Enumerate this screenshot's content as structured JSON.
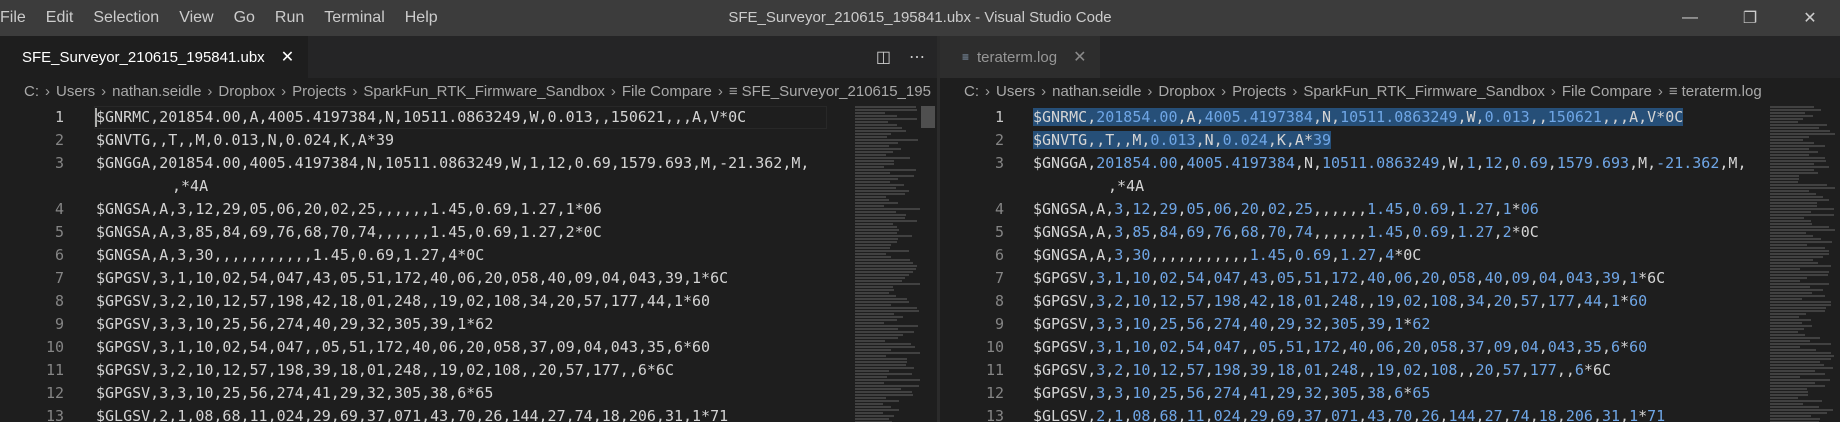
{
  "window": {
    "title": "SFE_Surveyor_210615_195841.ubx - Visual Studio Code",
    "menu": [
      "File",
      "Edit",
      "Selection",
      "View",
      "Go",
      "Run",
      "Terminal",
      "Help"
    ],
    "controls": {
      "minimize": "—",
      "restore": "❐",
      "close": "✕"
    }
  },
  "left_pane": {
    "tab": {
      "label": "SFE_Surveyor_210615_195841.ubx",
      "close": "✕"
    },
    "actions": {
      "split": "◫",
      "more": "⋯"
    },
    "breadcrumb": [
      "C:",
      "Users",
      "nathan.seidle",
      "Dropbox",
      "Projects",
      "SparkFun_RTK_Firmware_Sandbox",
      "File Compare",
      "SFE_Surveyor_210615_195"
    ],
    "lines": [
      {
        "n": "1",
        "text": "$GNRMC,201854.00,A,4005.4197384,N,10511.0863249,W,0.013,,150621,,,A,V*0C"
      },
      {
        "n": "2",
        "text": "$GNVTG,,T,,M,0.013,N,0.024,K,A*39"
      },
      {
        "n": "3",
        "text": "$GNGGA,201854.00,4005.4197384,N,10511.0863249,W,1,12,0.69,1579.693,M,-21.362,M,",
        "cont": ",*4A"
      },
      {
        "n": "4",
        "text": "$GNGSA,A,3,12,29,05,06,20,02,25,,,,,,1.45,0.69,1.27,1*06"
      },
      {
        "n": "5",
        "text": "$GNGSA,A,3,85,84,69,76,68,70,74,,,,,,1.45,0.69,1.27,2*0C"
      },
      {
        "n": "6",
        "text": "$GNGSA,A,3,30,,,,,,,,,,,1.45,0.69,1.27,4*0C"
      },
      {
        "n": "7",
        "text": "$GPGSV,3,1,10,02,54,047,43,05,51,172,40,06,20,058,40,09,04,043,39,1*6C"
      },
      {
        "n": "8",
        "text": "$GPGSV,3,2,10,12,57,198,42,18,01,248,,19,02,108,34,20,57,177,44,1*60"
      },
      {
        "n": "9",
        "text": "$GPGSV,3,3,10,25,56,274,40,29,32,305,39,1*62"
      },
      {
        "n": "10",
        "text": "$GPGSV,3,1,10,02,54,047,,05,51,172,40,06,20,058,37,09,04,043,35,6*60"
      },
      {
        "n": "11",
        "text": "$GPGSV,3,2,10,12,57,198,39,18,01,248,,19,02,108,,20,57,177,,6*6C"
      },
      {
        "n": "12",
        "text": "$GPGSV,3,3,10,25,56,274,41,29,32,305,38,6*65"
      },
      {
        "n": "13",
        "text": "$GLGSV,2,1,08,68,11,024,29,69,37,071,43,70,26,144,27,74,18,206,31,1*71"
      }
    ]
  },
  "right_pane": {
    "tab": {
      "label": "teraterm.log",
      "close": "✕"
    },
    "breadcrumb": [
      "C:",
      "Users",
      "nathan.seidle",
      "Dropbox",
      "Projects",
      "SparkFun_RTK_Firmware_Sandbox",
      "File Compare",
      "teraterm.log"
    ],
    "lines": [
      {
        "n": "1",
        "text": "$GNRMC,201854.00,A,4005.4197384,N,10511.0863249,W,0.013,,150621,,,A,V*0C"
      },
      {
        "n": "2",
        "text": "$GNVTG,,T,,M,0.013,N,0.024,K,A*39"
      },
      {
        "n": "3",
        "text": "$GNGGA,201854.00,4005.4197384,N,10511.0863249,W,1,12,0.69,1579.693,M,-21.362,M,",
        "cont": ",*4A"
      },
      {
        "n": "4",
        "text": "$GNGSA,A,3,12,29,05,06,20,02,25,,,,,,1.45,0.69,1.27,1*06"
      },
      {
        "n": "5",
        "text": "$GNGSA,A,3,85,84,69,76,68,70,74,,,,,,1.45,0.69,1.27,2*0C"
      },
      {
        "n": "6",
        "text": "$GNGSA,A,3,30,,,,,,,,,,,1.45,0.69,1.27,4*0C"
      },
      {
        "n": "7",
        "text": "$GPGSV,3,1,10,02,54,047,43,05,51,172,40,06,20,058,40,09,04,043,39,1*6C"
      },
      {
        "n": "8",
        "text": "$GPGSV,3,2,10,12,57,198,42,18,01,248,,19,02,108,34,20,57,177,44,1*60"
      },
      {
        "n": "9",
        "text": "$GPGSV,3,3,10,25,56,274,40,29,32,305,39,1*62"
      },
      {
        "n": "10",
        "text": "$GPGSV,3,1,10,02,54,047,,05,51,172,40,06,20,058,37,09,04,043,35,6*60"
      },
      {
        "n": "11",
        "text": "$GPGSV,3,2,10,12,57,198,39,18,01,248,,19,02,108,,20,57,177,,6*6C"
      },
      {
        "n": "12",
        "text": "$GPGSV,3,3,10,25,56,274,41,29,32,305,38,6*65"
      },
      {
        "n": "13",
        "text": "$GLGSV,2,1,08,68,11,024,29,69,37,071,43,70,26,144,27,74,18,206,31,1*71"
      }
    ]
  },
  "colors": {
    "background": "#1e1e1e",
    "titlebar": "#3c3c3c",
    "text": "#d4d4d4",
    "number_highlight": "#6fa6e6",
    "selection": "#264f78",
    "line_number": "#858585"
  }
}
